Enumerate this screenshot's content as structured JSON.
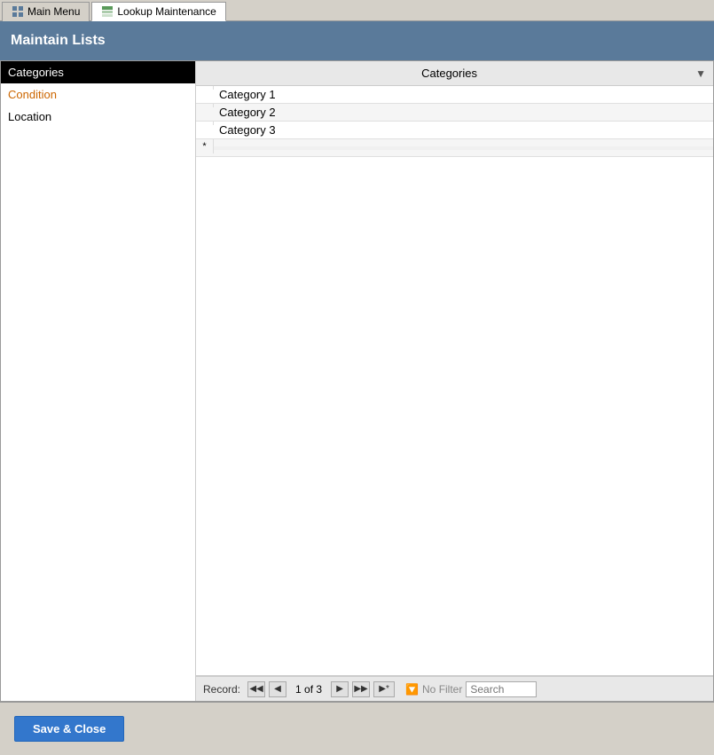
{
  "tabs": [
    {
      "id": "main-menu",
      "label": "Main Menu",
      "active": false,
      "icon": "grid-icon"
    },
    {
      "id": "lookup-maintenance",
      "label": "Lookup Maintenance",
      "active": true,
      "icon": "table-icon"
    }
  ],
  "title_bar": {
    "label": "Maintain Lists"
  },
  "left_panel": {
    "items": [
      {
        "id": "categories",
        "label": "Categories",
        "selected": true,
        "style": "selected"
      },
      {
        "id": "condition",
        "label": "Condition",
        "style": "condition"
      },
      {
        "id": "location",
        "label": "Location",
        "style": "location"
      }
    ]
  },
  "grid": {
    "header": "Categories",
    "dropdown_label": "▼",
    "rows": [
      {
        "selector": "",
        "value": "Category 1",
        "is_new": false
      },
      {
        "selector": "",
        "value": "Category 2",
        "is_new": false
      },
      {
        "selector": "",
        "value": "Category 3",
        "is_new": false
      },
      {
        "selector": "*",
        "value": "",
        "is_new": true
      }
    ]
  },
  "nav_bar": {
    "record_label": "Record:",
    "first_btn": "◀◀",
    "prev_btn": "◀",
    "position": "1 of 3",
    "next_btn": "▶",
    "last_btn": "▶▶",
    "new_btn": "▶*",
    "no_filter_label": "No Filter",
    "search_placeholder": "Search"
  },
  "bottom_bar": {
    "save_close_label": "Save & Close"
  }
}
